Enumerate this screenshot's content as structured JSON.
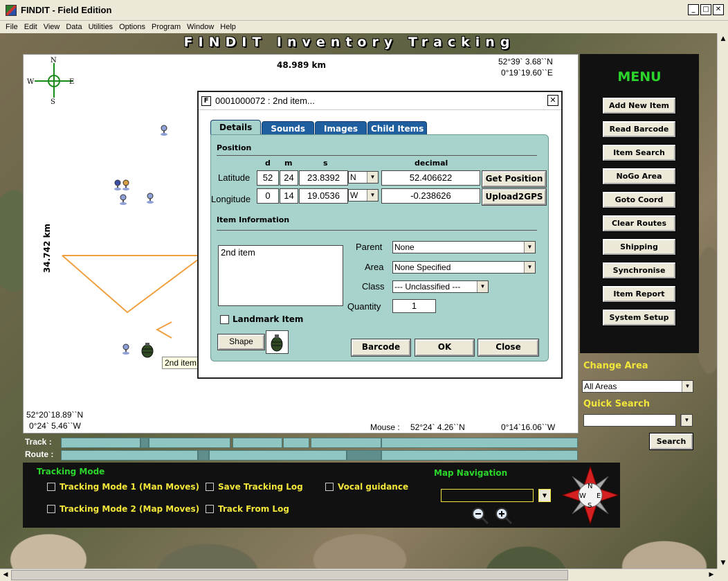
{
  "window": {
    "title": "FINDIT - Field Edition"
  },
  "menubar": [
    "File",
    "Edit",
    "View",
    "Data",
    "Utilities",
    "Options",
    "Program",
    "Window",
    "Help"
  ],
  "header": {
    "title": "FINDIT Inventory Tracking"
  },
  "map": {
    "scale_x": "48.989 km",
    "scale_y": "34.742 km",
    "top_right_lat": "52°39` 3.68``N",
    "top_right_lon": "0°19`19.60``E",
    "bottom_left_lat": "52°20`18.89``N",
    "bottom_left_lon": "0°24` 5.46``W",
    "mouse_label": "Mouse :",
    "mouse_lat": "52°24` 4.26``N",
    "mouse_lon": "0°14`16.06``W",
    "compass": {
      "n": "N",
      "s": "S",
      "e": "E",
      "w": "W"
    },
    "tooltip": "2nd item"
  },
  "dialog": {
    "title": "0001000072 : 2nd item...",
    "tabs": [
      "Details",
      "Sounds",
      "Images",
      "Child Items"
    ],
    "position_label": "Position",
    "col_d": "d",
    "col_m": "m",
    "col_s": "s",
    "col_decimal": "decimal",
    "latitude_label": "Latitude",
    "lat_d": "52",
    "lat_m": "24",
    "lat_s": "23.8392",
    "lat_dir": "N",
    "lat_decimal": "52.406622",
    "longitude_label": "Longitude",
    "lon_d": "0",
    "lon_m": "14",
    "lon_s": "19.0536",
    "lon_dir": "W",
    "lon_decimal": "-0.238626",
    "get_position": "Get Position",
    "upload2gps": "Upload2GPS",
    "item_info_label": "Item Information",
    "item_text": "2nd item",
    "parent_label": "Parent",
    "parent_value": "None",
    "area_label": "Area",
    "area_value": "None Specified",
    "class_label": "Class",
    "class_value": "--- Unclassified ---",
    "quantity_label": "Quantity",
    "quantity_value": "1",
    "landmark_label": "Landmark Item",
    "shape_button": "Shape",
    "barcode_button": "Barcode",
    "ok_button": "OK",
    "close_button": "Close"
  },
  "menu": {
    "heading": "MENU",
    "items": [
      "Add New Item",
      "Read Barcode",
      "Item Search",
      "NoGo Area",
      "Goto Coord",
      "Clear Routes",
      "Shipping",
      "Synchronise",
      "Item Report",
      "System Setup"
    ]
  },
  "side": {
    "change_area_label": "Change Area",
    "change_area_value": "All Areas",
    "quick_search_label": "Quick Search",
    "quick_search_value": "",
    "search_button": "Search"
  },
  "tracks": {
    "track_label": "Track :",
    "route_label": "Route :"
  },
  "bottom": {
    "tracking_mode_heading": "Tracking Mode",
    "tm1": "Tracking Mode 1 (Man Moves)",
    "tm2": "Tracking Mode 2 (Map Moves)",
    "save_log": "Save Tracking Log",
    "track_from_log": "Track From Log",
    "vocal": "Vocal guidance",
    "map_nav_heading": "Map Navigation",
    "compass": {
      "n": "N",
      "s": "S",
      "e": "E",
      "w": "W"
    }
  },
  "colors": {
    "menu_green": "#2bd52b",
    "label_yellow": "#f2e63a",
    "panel_teal": "#a8d2cc",
    "tab_blue": "#1f5f9f",
    "shape_orange": "#f0a040"
  }
}
